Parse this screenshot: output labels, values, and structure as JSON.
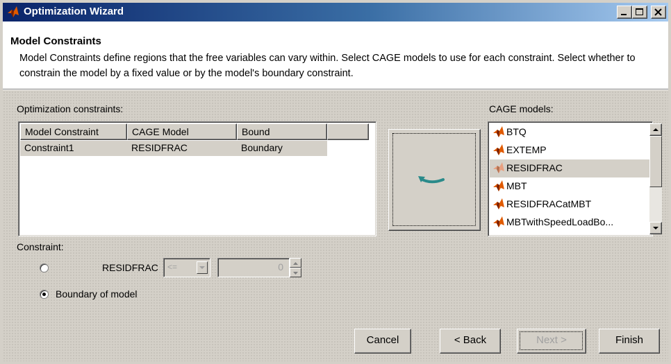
{
  "window": {
    "title": "Optimization Wizard"
  },
  "header": {
    "title": "Model Constraints",
    "description": "Model Constraints define regions that the free variables can vary within. Select CAGE models to use for each constraint. Select whether to constrain the model by a fixed value or by the model's boundary constraint."
  },
  "constraints": {
    "label": "Optimization constraints:",
    "columns": [
      "Model Constraint",
      "CAGE Model",
      "Bound"
    ],
    "rows": [
      [
        "Constraint1",
        "RESIDFRAC",
        "Boundary"
      ]
    ]
  },
  "cage_models": {
    "label": "CAGE models:",
    "items": [
      "BTQ",
      "EXTEMP",
      "RESIDFRAC",
      "MBT",
      "RESIDFRACatMBT",
      "MBTwithSpeedLoadBo..."
    ],
    "selected": "RESIDFRAC"
  },
  "constraint": {
    "label": "Constraint:",
    "fixed_option_label": "RESIDFRAC",
    "operator": "<=",
    "value": "0",
    "boundary_option_label": "Boundary of model",
    "selected_option": "boundary"
  },
  "buttons": {
    "cancel": "Cancel",
    "back": "< Back",
    "next": "Next >",
    "finish": "Finish"
  },
  "icons": {
    "app": "matlab-logo-icon",
    "assign": "assign-arrow-icon",
    "model": "cage-model-icon"
  },
  "colors": {
    "title_bar": "#0a246a",
    "assign_arrow": "#2a8a8a"
  }
}
